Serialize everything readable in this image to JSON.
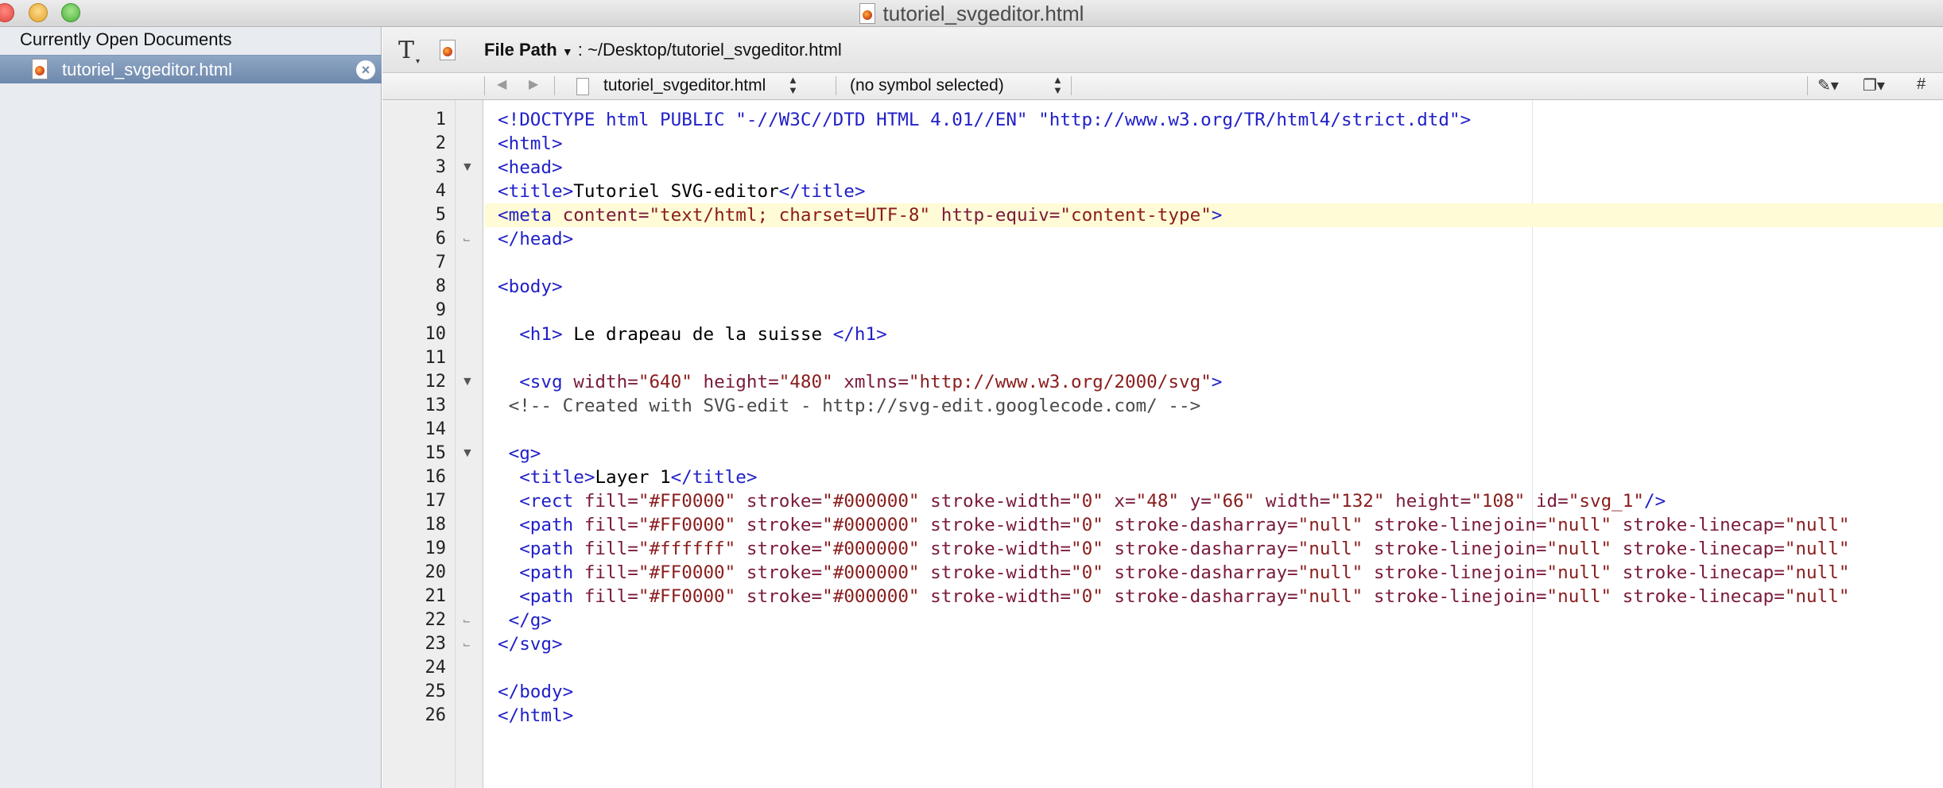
{
  "window": {
    "title": "tutoriel_svgeditor.html"
  },
  "sidebar": {
    "header": "Currently Open Documents",
    "items": [
      {
        "label": "tutoriel_svgeditor.html",
        "selected": true
      }
    ]
  },
  "toolbar": {
    "file_path_label": "File Path",
    "file_path_sep": ":",
    "file_path_value": "~/Desktop/tutoriel_svgeditor.html"
  },
  "navbar": {
    "file": "tutoriel_svgeditor.html",
    "symbol": "(no symbol selected)",
    "line_number_icon": "#"
  },
  "editor": {
    "highlighted_line": 5,
    "lines": [
      "1",
      "2",
      "3",
      "4",
      "5",
      "6",
      "7",
      "8",
      "9",
      "10",
      "11",
      "12",
      "13",
      "14",
      "15",
      "16",
      "17",
      "18",
      "19",
      "20",
      "21",
      "22",
      "23",
      "24",
      "25",
      "26"
    ],
    "code": {
      "l1": "<!DOCTYPE html PUBLIC \"-//W3C//DTD HTML 4.01//EN\" \"http://www.w3.org/TR/html4/strict.dtd\">",
      "l2": "<html>",
      "l3": "<head>",
      "l4a": "<title>",
      "l4b": "Tutoriel SVG-editor",
      "l4c": "</title>",
      "l5a": "<meta",
      "l5b": " content=",
      "l5c": "\"text/html; charset=UTF-8\"",
      "l5d": " http-equiv=",
      "l5e": "\"content-type\"",
      "l5f": ">",
      "l6": "</head>",
      "l8": "<body>",
      "l10a": "  <h1>",
      "l10b": " Le drapeau de la suisse ",
      "l10c": "</h1>",
      "l12a": "  <svg",
      "l12b": " width=",
      "l12c": "\"640\"",
      "l12d": " height=",
      "l12e": "\"480\"",
      "l12f": " xmlns=",
      "l12g": "\"http://www.w3.org/2000/svg\"",
      "l12h": ">",
      "l13": " <!-- Created with SVG-edit - http://svg-edit.googlecode.com/ -->",
      "l15": " <g>",
      "l16a": "  <title>",
      "l16b": "Layer 1",
      "l16c": "</title>",
      "l17a": "  <rect",
      "l17b": " fill=",
      "l17c": "\"#FF0000\"",
      "l17d": " stroke=",
      "l17e": "\"#000000\"",
      "l17f": " stroke-width=",
      "l17g": "\"0\"",
      "l17h": " x=",
      "l17i": "\"48\"",
      "l17j": " y=",
      "l17k": "\"66\"",
      "l17l": " width=",
      "l17m": "\"132\"",
      "l17n": " height=",
      "l17o": "\"108\"",
      "l17p": " id=",
      "l17q": "\"svg_1\"",
      "l17r": "/>",
      "path_tag": "  <path",
      "fill_attr": " fill=",
      "stroke_attr": " stroke=",
      "sw_attr": " stroke-width=",
      "sda_attr": " stroke-dasharray=",
      "slj_attr": " stroke-linejoin=",
      "slc_attr": " stroke-linecap=",
      "red": "\"#FF0000\"",
      "white": "\"#ffffff\"",
      "black": "\"#000000\"",
      "zero": "\"0\"",
      "null": "\"null\"",
      "l22": " </g>",
      "l23": "</svg>",
      "l25": "</body>",
      "l26": "</html>"
    }
  },
  "colors": {
    "tag": "#1f1fc8",
    "attribute": "#7a1a3b",
    "string": "#8a1c1c",
    "highlight": "#fffbd6",
    "selection": "#7c95b7"
  }
}
